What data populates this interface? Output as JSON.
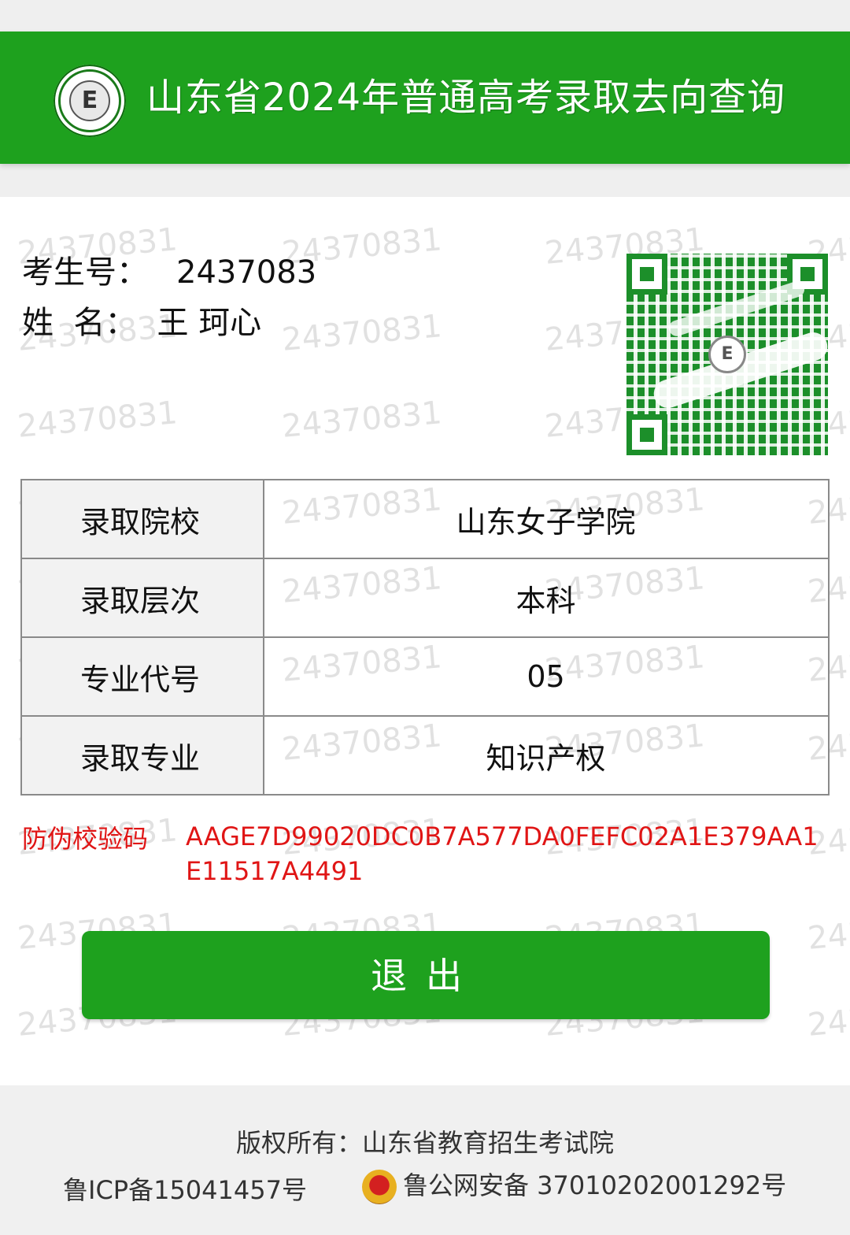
{
  "header": {
    "logo": "exam-authority-seal",
    "title": "山东省2024年普通高考录取去向查询"
  },
  "watermark": "24370831",
  "student": {
    "id_label": "考生号：",
    "id_value": "2437083",
    "name_label": "姓  名：",
    "name_value": "王 珂心"
  },
  "qr": {
    "icon": "qr-code"
  },
  "admission": {
    "rows": [
      {
        "label": "录取院校",
        "value": "山东女子学院"
      },
      {
        "label": "录取层次",
        "value": "本科"
      },
      {
        "label": "专业代号",
        "value": "05"
      },
      {
        "label": "录取专业",
        "value": "知识产权"
      }
    ]
  },
  "anti_fake": {
    "label": "防伪校验码",
    "code": "AAGE7D99020DC0B7A577DA0FEFC02A1E379AA1E11517A4491"
  },
  "actions": {
    "exit_label": "退出"
  },
  "footer": {
    "copyright": "版权所有：山东省教育招生考试院",
    "icp": "鲁ICP备15041457号",
    "police_record": "鲁公网安备 37010202001292号"
  },
  "colors": {
    "brand_green": "#1ea11e",
    "alert_red": "#e01515"
  }
}
